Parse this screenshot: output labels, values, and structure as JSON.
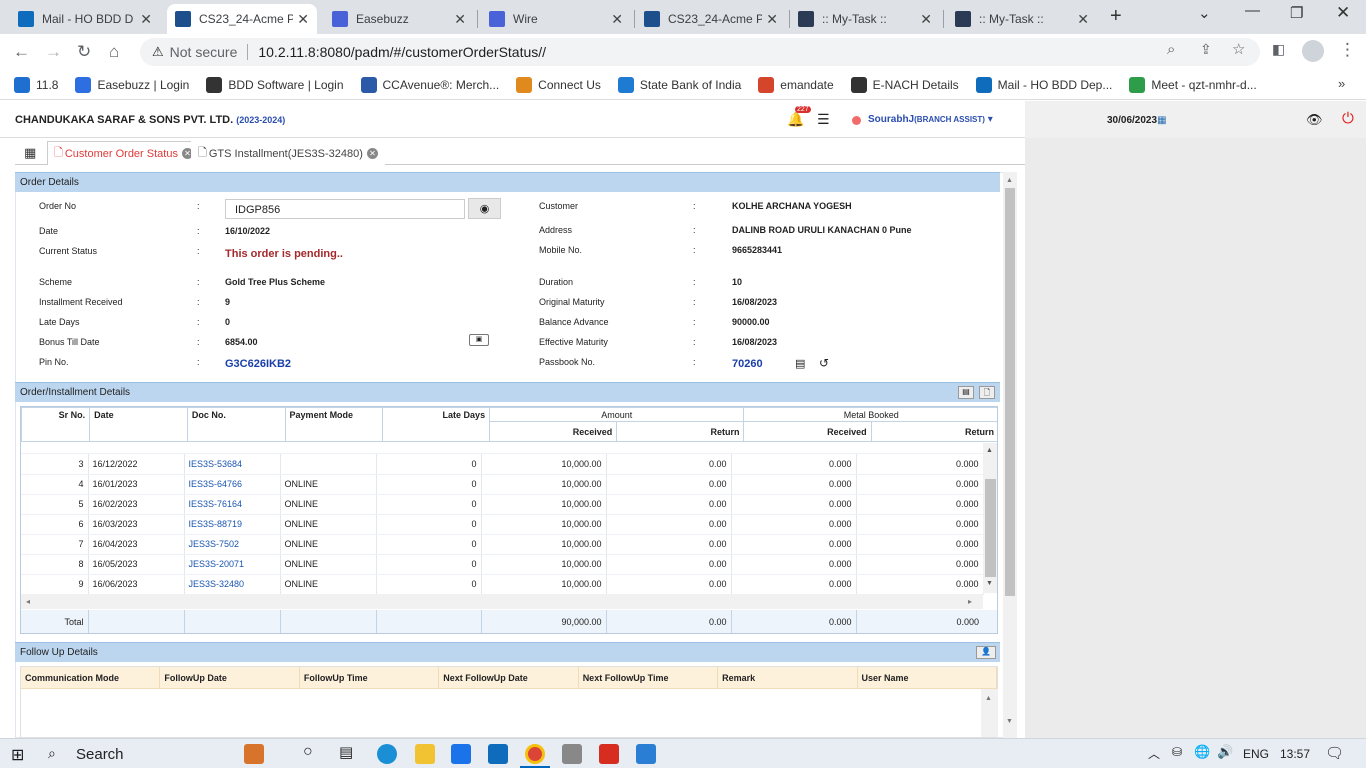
{
  "browser": {
    "tabs": [
      {
        "title": "Mail - HO BDD D",
        "icon": "outlook-icon",
        "active": false
      },
      {
        "title": "CS23_24-Acme P",
        "icon": "app-icon",
        "active": true
      },
      {
        "title": "Easebuzz",
        "icon": "easebuzz-icon",
        "active": false
      },
      {
        "title": "Wire",
        "icon": "easebuzz-icon",
        "active": false
      },
      {
        "title": "CS23_24-Acme P",
        "icon": "app-icon",
        "active": false
      },
      {
        "title": ":: My-Task ::",
        "icon": "react-icon",
        "active": false
      },
      {
        "title": ":: My-Task ::",
        "icon": "react-icon",
        "active": false
      }
    ],
    "not_secure": "Not secure",
    "url": "10.2.11.8:8080/padm/#/customerOrderStatus//",
    "bookmarks": [
      {
        "label": "11.8",
        "color": "#1f6fd1"
      },
      {
        "label": "Easebuzz | Login",
        "color": "#2d6fe0"
      },
      {
        "label": "BDD Software | Login",
        "color": "#333333"
      },
      {
        "label": "CCAvenue®: Merch...",
        "color": "#2b5aa8"
      },
      {
        "label": "Connect Us",
        "color": "#e08a1e"
      },
      {
        "label": "State Bank of India",
        "color": "#1f7ad1"
      },
      {
        "label": "emandate",
        "color": "#d4452b"
      },
      {
        "label": "E-NACH Details",
        "color": "#333333"
      },
      {
        "label": "Mail - HO BDD Dep...",
        "color": "#0f6cbd"
      },
      {
        "label": "Meet - qzt-nmhr-d...",
        "color": "#2e9d4a"
      }
    ]
  },
  "header": {
    "company": "CHANDUKAKA SARAF & SONS PVT. LTD.",
    "year": "(2023-2024)",
    "notif_count": "227",
    "user": "SourabhJ",
    "role": "(BRANCH ASSIST)",
    "date": "30/06/2023"
  },
  "page_tabs": [
    {
      "label": "Customer Order Status",
      "active": true
    },
    {
      "label": "GTS Installment(JES3S-32480)",
      "active": false
    }
  ],
  "order_details": {
    "title": "Order Details",
    "order_no_label": "Order No",
    "order_no": "IDGP856",
    "date_label": "Date",
    "date": "16/10/2022",
    "status_label": "Current Status",
    "status": "This order is pending..",
    "scheme_label": "Scheme",
    "scheme": "Gold Tree Plus Scheme",
    "inst_label": "Installment Received",
    "inst": "9",
    "late_label": "Late Days",
    "late": "0",
    "bonus_label": "Bonus Till Date",
    "bonus": "6854.00",
    "pin_label": "Pin No.",
    "pin": "G3C626IKB2",
    "customer_label": "Customer",
    "customer": "KOLHE ARCHANA YOGESH",
    "address_label": "Address",
    "address": "DALINB ROAD URULI KANACHAN 0 Pune",
    "mobile_label": "Mobile No.",
    "mobile": "9665283441",
    "duration_label": "Duration",
    "duration": "10",
    "orig_label": "Original Maturity",
    "orig": "16/08/2023",
    "balance_label": "Balance Advance",
    "balance": "90000.00",
    "eff_label": "Effective Maturity",
    "eff": "16/08/2023",
    "passbook_label": "Passbook No.",
    "passbook": "70260"
  },
  "installments": {
    "title": "Order/Installment Details",
    "headers": {
      "sr": "Sr No.",
      "date": "Date",
      "doc": "Doc No.",
      "mode": "Payment Mode",
      "late": "Late Days",
      "amount": "Amount",
      "metal": "Metal Booked",
      "received": "Received",
      "return": "Return"
    },
    "rows": [
      {
        "sr": "3",
        "date": "16/12/2022",
        "doc": "IES3S-53684",
        "mode": "",
        "late": "0",
        "amt_rec": "10,000.00",
        "amt_ret": "0.00",
        "met_rec": "0.000",
        "met_ret": "0.000"
      },
      {
        "sr": "4",
        "date": "16/01/2023",
        "doc": "IES3S-64766",
        "mode": "ONLINE",
        "late": "0",
        "amt_rec": "10,000.00",
        "amt_ret": "0.00",
        "met_rec": "0.000",
        "met_ret": "0.000"
      },
      {
        "sr": "5",
        "date": "16/02/2023",
        "doc": "IES3S-76164",
        "mode": "ONLINE",
        "late": "0",
        "amt_rec": "10,000.00",
        "amt_ret": "0.00",
        "met_rec": "0.000",
        "met_ret": "0.000"
      },
      {
        "sr": "6",
        "date": "16/03/2023",
        "doc": "IES3S-88719",
        "mode": "ONLINE",
        "late": "0",
        "amt_rec": "10,000.00",
        "amt_ret": "0.00",
        "met_rec": "0.000",
        "met_ret": "0.000"
      },
      {
        "sr": "7",
        "date": "16/04/2023",
        "doc": "JES3S-7502",
        "mode": "ONLINE",
        "late": "0",
        "amt_rec": "10,000.00",
        "amt_ret": "0.00",
        "met_rec": "0.000",
        "met_ret": "0.000"
      },
      {
        "sr": "8",
        "date": "16/05/2023",
        "doc": "JES3S-20071",
        "mode": "ONLINE",
        "late": "0",
        "amt_rec": "10,000.00",
        "amt_ret": "0.00",
        "met_rec": "0.000",
        "met_ret": "0.000"
      },
      {
        "sr": "9",
        "date": "16/06/2023",
        "doc": "JES3S-32480",
        "mode": "ONLINE",
        "late": "0",
        "amt_rec": "10,000.00",
        "amt_ret": "0.00",
        "met_rec": "0.000",
        "met_ret": "0.000"
      }
    ],
    "total_label": "Total",
    "total": {
      "amt_rec": "90,000.00",
      "amt_ret": "0.00",
      "met_rec": "0.000",
      "met_ret": "0.000"
    }
  },
  "followup": {
    "title": "Follow Up Details",
    "headers": [
      "Communication Mode",
      "FollowUp Date",
      "FollowUp Time",
      "Next FollowUp Date",
      "Next FollowUp Time",
      "Remark",
      "User Name"
    ]
  },
  "taskbar": {
    "search": "Search",
    "lang": "ENG",
    "time": "13:57"
  }
}
